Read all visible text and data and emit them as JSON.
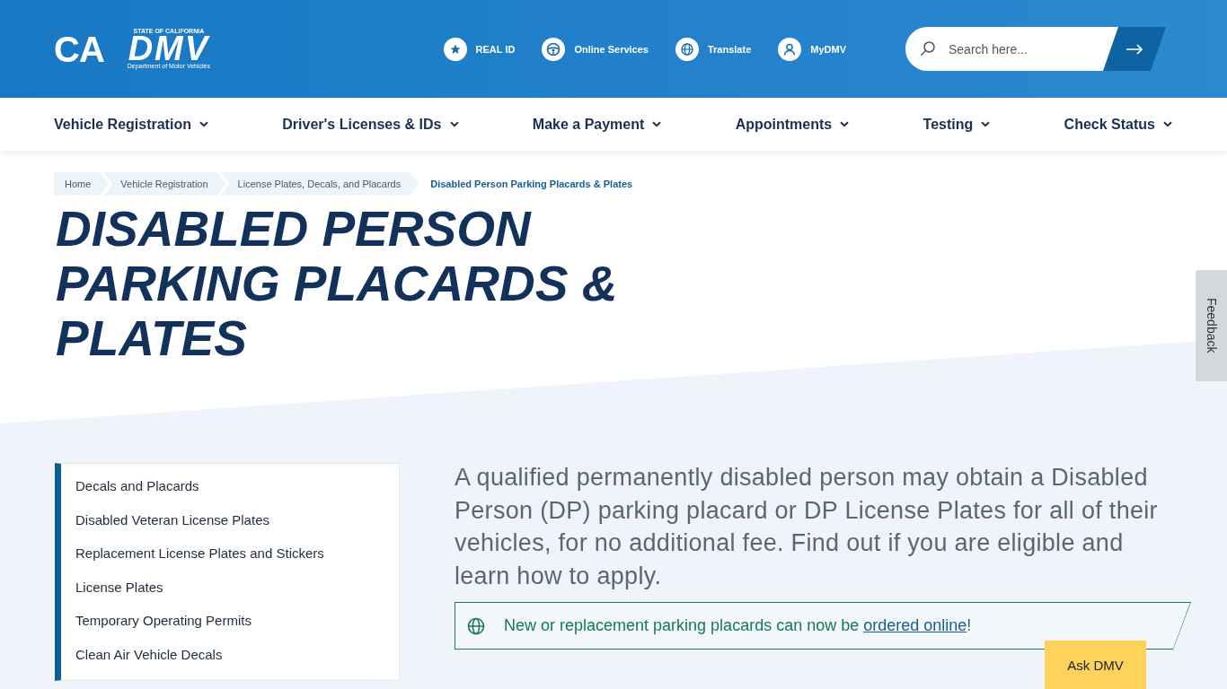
{
  "header": {
    "state_logo": "CA",
    "dmv_logo": {
      "caption": "STATE OF CALIFORNIA",
      "name": "DMV",
      "subtitle": "Department of Motor Vehicles"
    },
    "quick_links": [
      "REAL ID",
      "Online Services",
      "Translate",
      "MyDMV"
    ],
    "search": {
      "placeholder": "Search here..."
    }
  },
  "nav": [
    "Vehicle Registration",
    "Driver's Licenses & IDs",
    "Make a Payment",
    "Appointments",
    "Testing",
    "Check Status"
  ],
  "breadcrumb": [
    {
      "label": "Home",
      "current": false
    },
    {
      "label": "Vehicle Registration",
      "current": false
    },
    {
      "label": "License Plates, Decals, and Placards",
      "current": false
    },
    {
      "label": "Disabled Person Parking Placards & Plates",
      "current": true
    }
  ],
  "title": "DISABLED PERSON PARKING PLACARDS & PLATES",
  "sidebar": [
    "Decals and Placards",
    "Disabled Veteran License Plates",
    "Replacement License Plates and Stickers",
    "License Plates",
    "Temporary Operating Permits",
    "Clean Air Vehicle Decals"
  ],
  "intro": "A qualified permanently disabled person may obtain a Disabled Person (DP) parking placard or DP License Plates for all of their vehicles, for no additional fee. Find out if you are eligible and learn how to apply.",
  "alert": {
    "text": "New or replacement parking placards can now be",
    "link": "ordered online",
    "after": "!"
  },
  "feedback": "Feedback",
  "ask_dmv": "Ask DMV"
}
